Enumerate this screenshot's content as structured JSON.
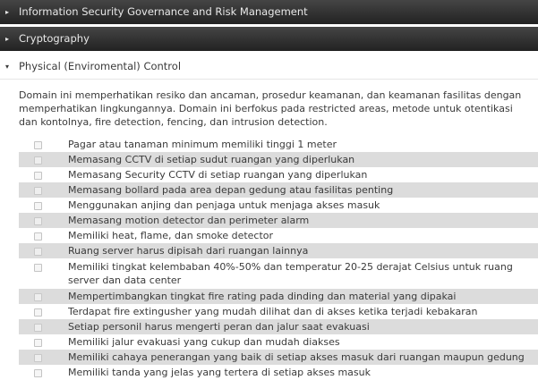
{
  "sections": [
    {
      "title": "Information Security Governance and Risk Management",
      "arrow": "▸"
    },
    {
      "title": "Cryptography",
      "arrow": "▸"
    }
  ],
  "open_section": {
    "title": "Physical (Enviromental) Control",
    "arrow": "▾",
    "description": "Domain ini memperhatikan resiko dan ancaman, prosedur keamanan, dan keamanan fasilitas dengan memperhatikan lingkungannya. Domain ini berfokus pada restricted areas, metode untuk otentikasi dan kontolnya, fire detection, fencing, dan intrusion detection.",
    "items": [
      "Pagar atau tanaman minimum memiliki tinggi 1 meter",
      "Memasang CCTV di setiap sudut ruangan yang diperlukan",
      "Memasang Security CCTV di setiap ruangan yang diperlukan",
      "Memasang bollard pada area depan gedung atau fasilitas penting",
      "Menggunakan anjing dan penjaga untuk menjaga akses masuk",
      "Memasang motion detector dan perimeter alarm",
      "Memiliki heat, flame, dan smoke detector",
      "Ruang server harus dipisah dari ruangan lainnya",
      "Memiliki tingkat kelembaban 40%-50% dan temperatur 20-25 derajat Celsius untuk ruang server dan data center",
      "Mempertimbangkan tingkat fire rating pada dinding dan material yang dipakai",
      "Terdapat fire extingusher yang mudah dilihat dan di akses ketika terjadi kebakaran",
      "Setiap personil harus mengerti peran dan jalur saat evakuasi",
      "Memiliki jalur evakuasi yang cukup dan mudah diakses",
      "Memiliki cahaya penerangan yang baik di setiap akses masuk dari ruangan maupun gedung",
      "Memiliki tanda yang jelas yang tertera di setiap akses masuk"
    ]
  },
  "colors": {
    "header_dark": "#333333",
    "header_text": "#e8e8e8",
    "row_shade": "#dcdcdc",
    "text": "#3a3a3a"
  }
}
